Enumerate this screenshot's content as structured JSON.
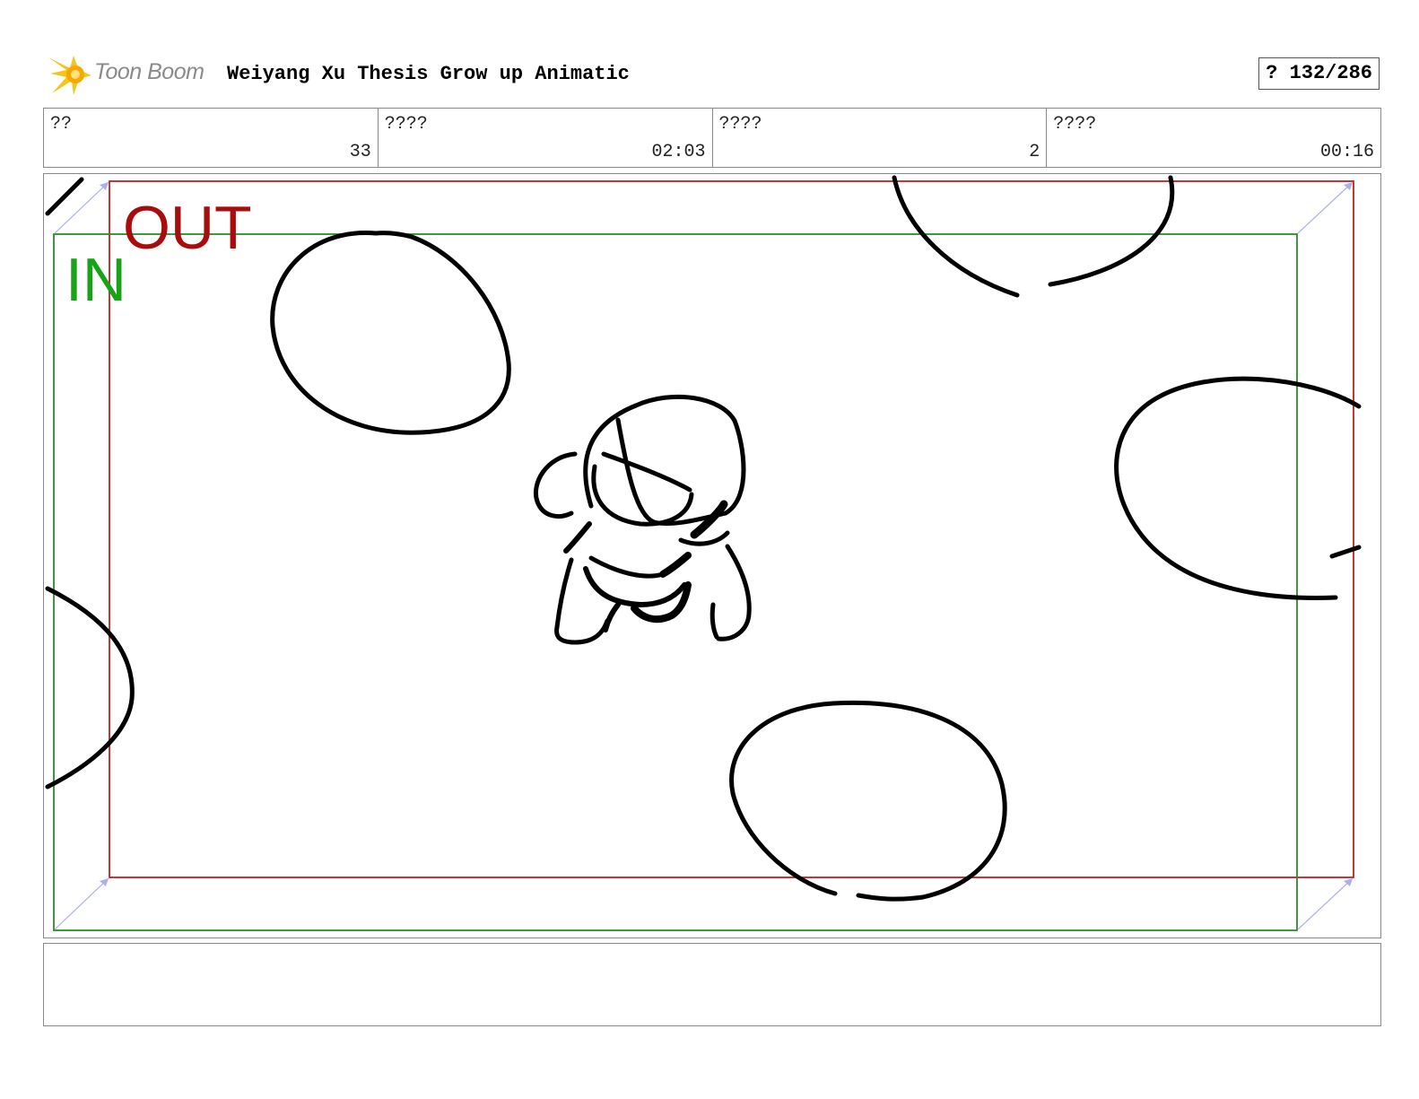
{
  "header": {
    "brand": "Toon Boom",
    "title": "Weiyang Xu Thesis Grow up Animatic",
    "page_indicator": "? 132/286"
  },
  "info": {
    "cells": [
      {
        "label": "??",
        "value": "33"
      },
      {
        "label": "????",
        "value": "02:03"
      },
      {
        "label": "????",
        "value": "2"
      },
      {
        "label": "????",
        "value": "00:16"
      }
    ]
  },
  "panel": {
    "in_label": "IN",
    "out_label": "OUT"
  },
  "notes": {
    "text": ""
  },
  "colors": {
    "in_frame": "#2e8b2e",
    "out_frame": "#c41e1e",
    "in_text": "#16a316",
    "out_text": "#a80c0c",
    "logo": "#f5c518"
  },
  "icons": {
    "logo": "toon-boom-burst-logo"
  }
}
